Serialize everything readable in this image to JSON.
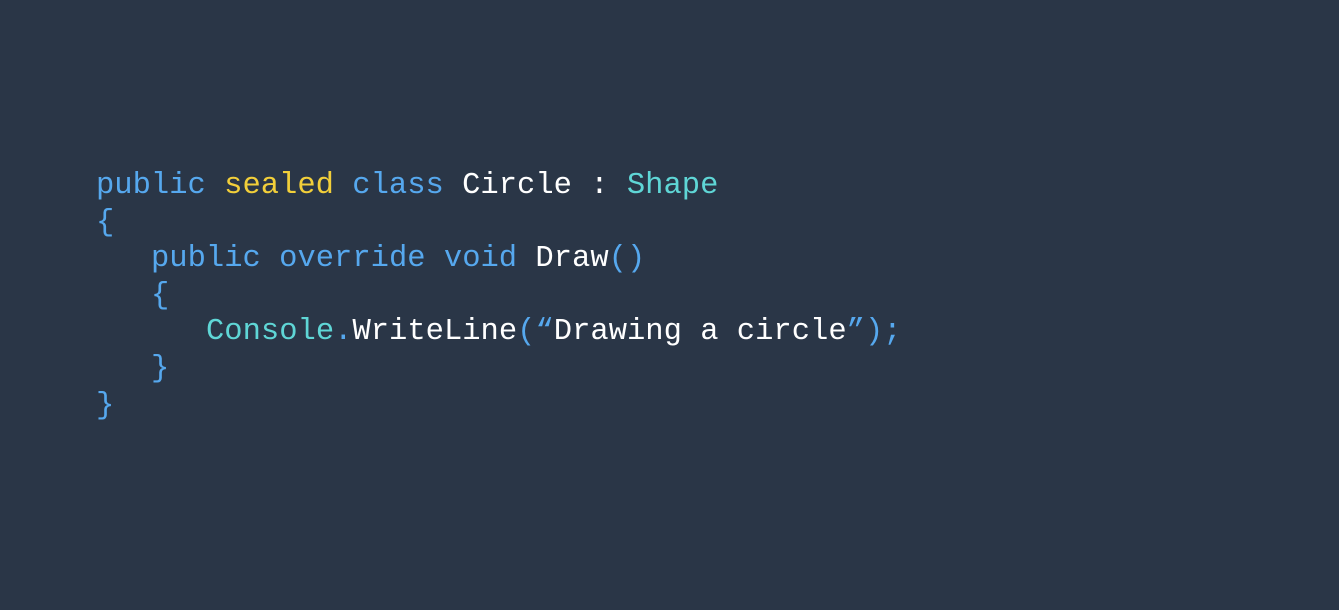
{
  "code": {
    "line1": {
      "kw_public": "public",
      "kw_sealed": "sealed",
      "kw_class": "class",
      "class_name": "Circle",
      "colon": ":",
      "base_type": "Shape"
    },
    "line2": {
      "open_brace": "{"
    },
    "line3": {
      "kw_public": "public",
      "kw_override": "override",
      "kw_void": "void",
      "method_name": "Draw",
      "parens": "()"
    },
    "line4": {
      "open_brace": "{"
    },
    "line5": {
      "type_console": "Console",
      "dot": ".",
      "method_writeline": "WriteLine",
      "open_paren_quote": "(“",
      "string_text": "Drawing a circle",
      "close_quote_paren": "”);"
    },
    "line6": {
      "close_brace": "}"
    },
    "line7": {
      "close_brace": "}"
    }
  },
  "colors": {
    "background": "#2a3647",
    "keyword": "#56a8ee",
    "modifier_keyword": "#f2cf3a",
    "type": "#5fd6d6",
    "identifier": "#ffffff"
  }
}
